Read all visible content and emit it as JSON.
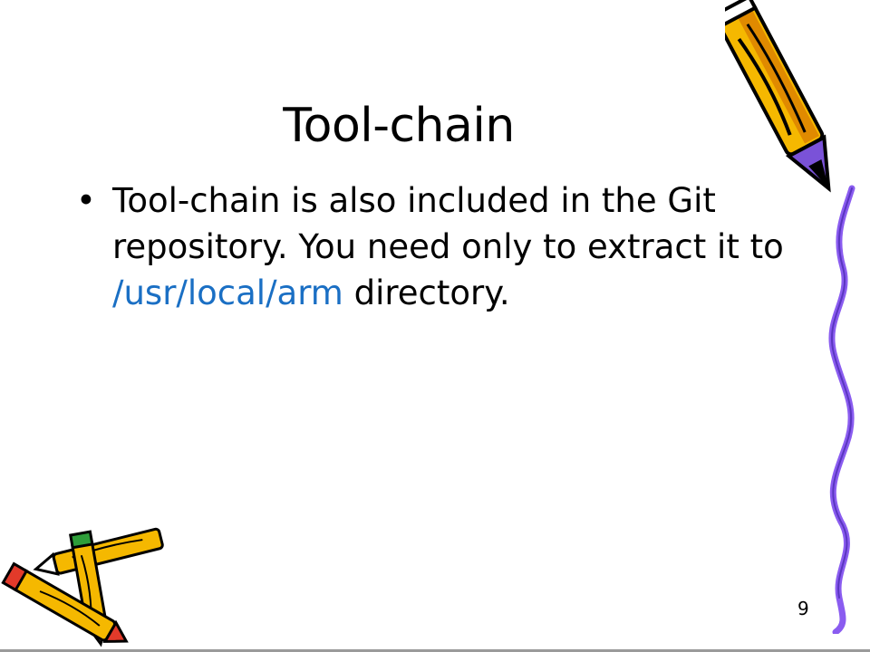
{
  "slide": {
    "title": "Tool-chain",
    "bullet_symbol": "•",
    "bullet_text_before": "Tool-chain is also included in the Git repository. You need only to extract it to ",
    "bullet_highlight": "/usr/local/arm",
    "bullet_text_after": " directory.",
    "page_number": "9"
  },
  "colors": {
    "highlight": "#1a6fc4",
    "pencil_body": "#f5b800",
    "pencil_shadow": "#e08a00",
    "pencil_tip": "#7a52d8",
    "squiggle": "#8a5cf0",
    "eraser_red": "#e23a2a",
    "eraser_green": "#2e9e3a"
  },
  "icons": [
    "pencil-icon",
    "pencils-clipart-icon",
    "squiggle-line-icon"
  ]
}
